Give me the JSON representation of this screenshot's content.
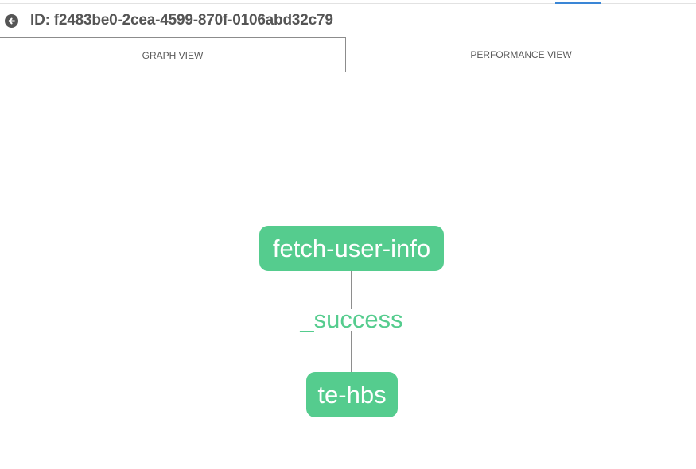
{
  "header": {
    "back_icon": "arrow-left-circle-icon",
    "title": "ID: f2483be0-2cea-4599-870f-0106abd32c79"
  },
  "tabs": [
    {
      "label": "GRAPH VIEW",
      "active": true
    },
    {
      "label": "PERFORMANCE VIEW",
      "active": false
    }
  ],
  "graph": {
    "nodes": [
      {
        "label": "fetch-user-info"
      },
      {
        "label": "te-hbs"
      }
    ],
    "edges": [
      {
        "label": "_success"
      }
    ],
    "node_color": "#55cc8e",
    "edge_color": "#8e8e8e"
  }
}
